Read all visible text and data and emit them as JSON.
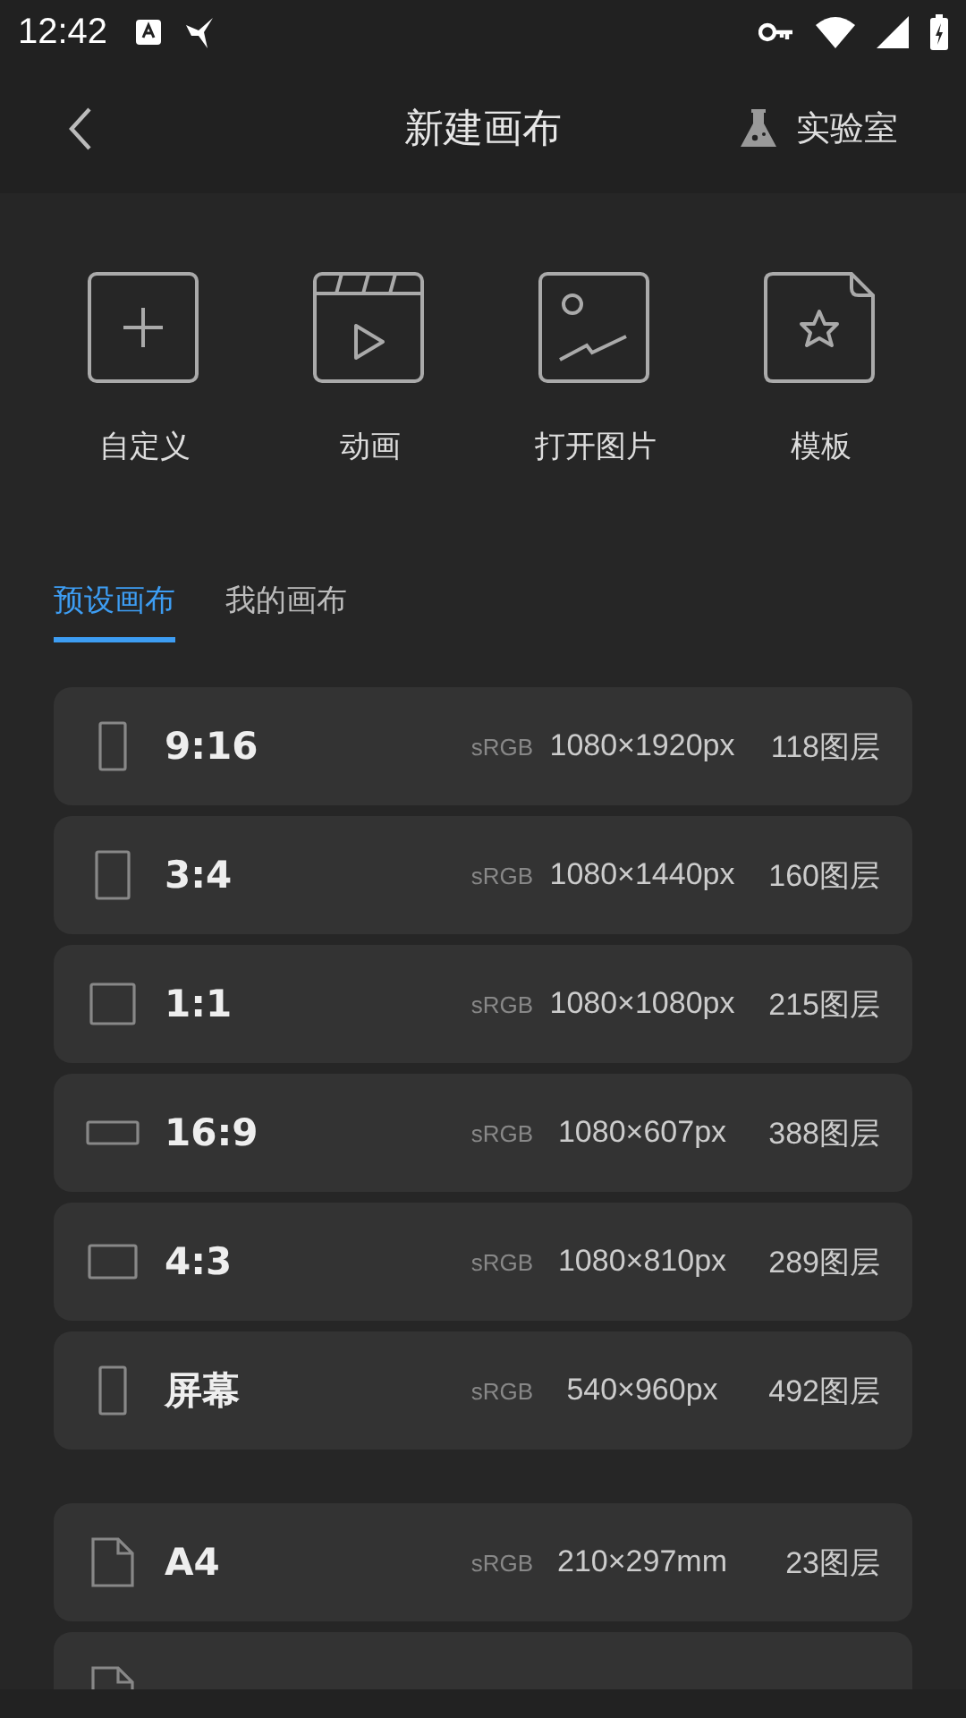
{
  "status_bar": {
    "time": "12:42"
  },
  "header": {
    "title": "新建画布",
    "lab_label": "实验室"
  },
  "actions": [
    {
      "kind": "custom",
      "label": "自定义"
    },
    {
      "kind": "animation",
      "label": "动画"
    },
    {
      "kind": "image",
      "label": "打开图片"
    },
    {
      "kind": "template",
      "label": "模板"
    }
  ],
  "tabs": [
    {
      "label": "预设画布",
      "selected": true
    },
    {
      "label": "我的画布",
      "selected": false
    }
  ],
  "groups": [
    {
      "rows": [
        {
          "kind": "tall",
          "name": "9:16",
          "color_space": "sRGB",
          "size": "1080×1920px",
          "layers": "118图层"
        },
        {
          "kind": "portrait",
          "name": "3:4",
          "color_space": "sRGB",
          "size": "1080×1440px",
          "layers": "160图层"
        },
        {
          "kind": "square",
          "name": "1:1",
          "color_space": "sRGB",
          "size": "1080×1080px",
          "layers": "215图层"
        },
        {
          "kind": "wide",
          "name": "16:9",
          "color_space": "sRGB",
          "size": "1080×607px",
          "layers": "388图层"
        },
        {
          "kind": "landscape",
          "name": "4:3",
          "color_space": "sRGB",
          "size": "1080×810px",
          "layers": "289图层"
        },
        {
          "kind": "tall",
          "name": "屏幕",
          "color_space": "sRGB",
          "size": "540×960px",
          "layers": "492图层"
        }
      ]
    },
    {
      "rows": [
        {
          "kind": "page",
          "name": "A4",
          "color_space": "sRGB",
          "size": "210×297mm",
          "layers": "23图层"
        },
        {
          "kind": "page"
        }
      ]
    }
  ]
}
